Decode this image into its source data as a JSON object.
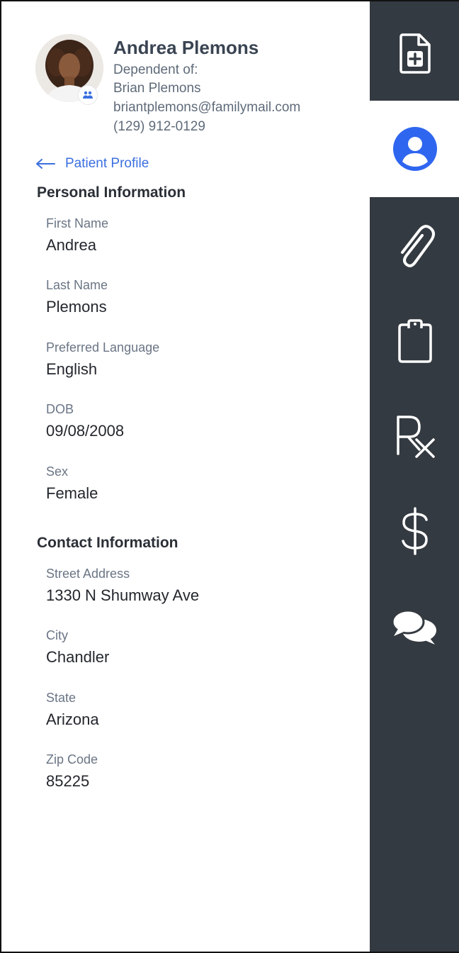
{
  "header": {
    "name": "Andrea Plemons",
    "dependent_label": "Dependent of:",
    "guardian_name": "Brian Plemons",
    "guardian_email": "briantplemons@familymail.com",
    "guardian_phone": "(129) 912-0129"
  },
  "back_link": {
    "label": "Patient Profile",
    "icon": "arrow-left-icon"
  },
  "personal": {
    "title": "Personal Information",
    "fields": [
      {
        "label": "First Name",
        "value": "Andrea"
      },
      {
        "label": "Last Name",
        "value": "Plemons"
      },
      {
        "label": "Preferred Language",
        "value": "English"
      },
      {
        "label": "DOB",
        "value": "09/08/2008"
      },
      {
        "label": "Sex",
        "value": "Female"
      }
    ]
  },
  "contact": {
    "title": "Contact Information",
    "fields": [
      {
        "label": "Street Address",
        "value": "1330 N Shumway Ave"
      },
      {
        "label": "City",
        "value": "Chandler"
      },
      {
        "label": "State",
        "value": "Arizona"
      },
      {
        "label": "Zip Code",
        "value": "85225"
      }
    ]
  },
  "sidebar": {
    "items": [
      {
        "icon": "medical-file-add-icon",
        "active": false
      },
      {
        "icon": "user-profile-icon",
        "active": true
      },
      {
        "icon": "paperclip-icon",
        "active": false
      },
      {
        "icon": "clipboard-icon",
        "active": false
      },
      {
        "icon": "prescription-rx-icon",
        "active": false
      },
      {
        "icon": "dollar-billing-icon",
        "active": false
      },
      {
        "icon": "chat-bubbles-icon",
        "active": false
      }
    ]
  },
  "colors": {
    "sidebar_bg": "#343a41",
    "accent_blue": "#3b6fe0",
    "profile_icon_blue": "#2f66f0"
  }
}
